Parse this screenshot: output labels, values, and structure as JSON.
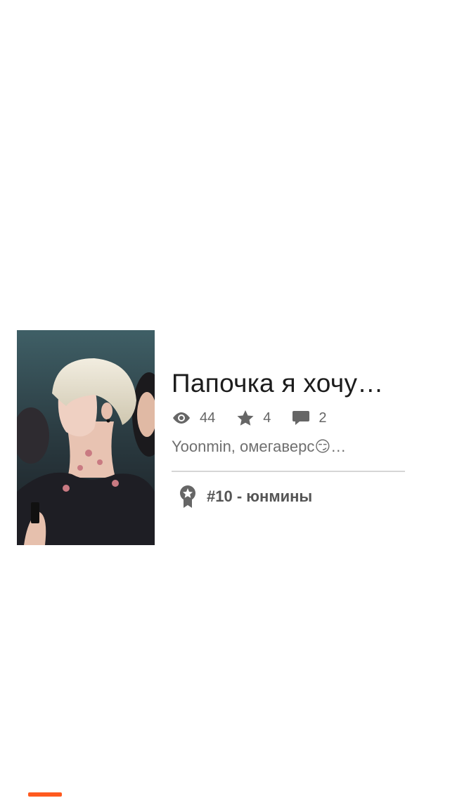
{
  "story": {
    "title": "Папочка я хочу…",
    "stats": {
      "views": "44",
      "votes": "4",
      "comments": "2"
    },
    "tags": "Yoonmin, омегаверс😏…",
    "ranking": {
      "label": "#10 - юнмины"
    },
    "cover_icon": "cover-image"
  },
  "icons": {
    "views": "eye-icon",
    "votes": "star-icon",
    "comments": "comment-icon",
    "ranking": "ribbon-award-icon"
  },
  "colors": {
    "accent": "#ff5a1f",
    "muted_text": "#666666",
    "divider": "#d6d6d6"
  }
}
